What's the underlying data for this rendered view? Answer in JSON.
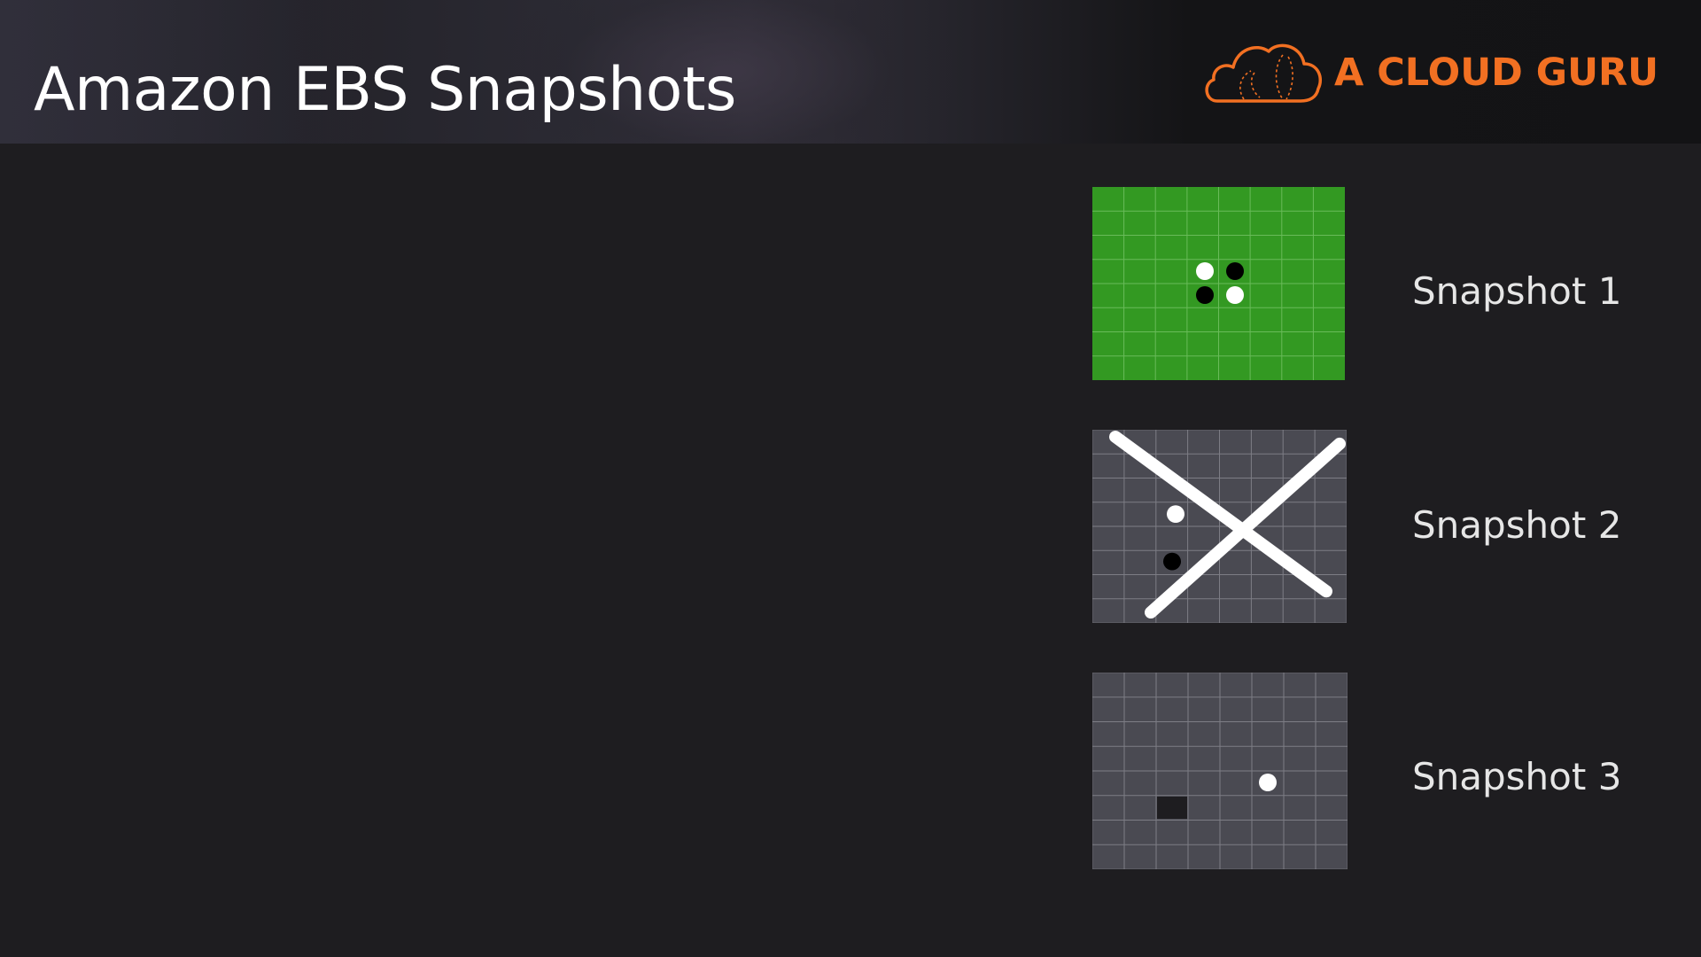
{
  "slide": {
    "title": "Amazon EBS Snapshots",
    "logo": {
      "text": "A CLOUD GURU",
      "icon": "cloud-icon",
      "color": "#f27022"
    }
  },
  "snapshots": [
    {
      "label": "Snapshot 1",
      "style": "green-grid",
      "background": "#339922",
      "marks": [
        "white-dot",
        "black-dot",
        "black-dot",
        "white-dot"
      ]
    },
    {
      "label": "Snapshot 2",
      "style": "gray-grid-crossed-out",
      "background": "#4a4a52",
      "marks": [
        "white-dot",
        "black-dot",
        "x-mark"
      ]
    },
    {
      "label": "Snapshot 3",
      "style": "gray-grid",
      "background": "#4a4a52",
      "marks": [
        "white-dot",
        "dark-square"
      ]
    }
  ]
}
